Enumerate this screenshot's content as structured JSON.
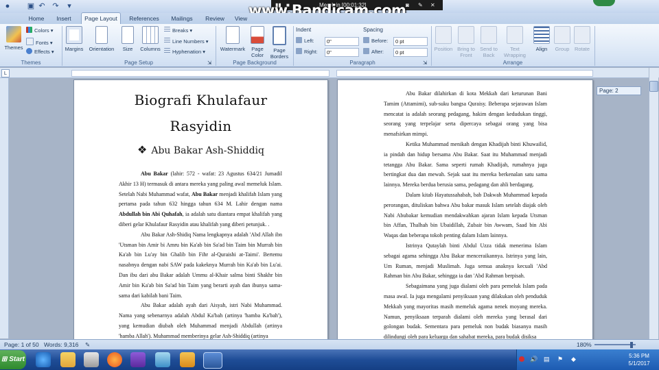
{
  "watermark": "www.Bandicam.com",
  "recorder": {
    "title": "Merek in [00:01:32]"
  },
  "tabs": [
    "Home",
    "Insert",
    "Page Layout",
    "References",
    "Mailings",
    "Review",
    "View"
  ],
  "ribbon": {
    "themes": {
      "themes": "Themes",
      "colors": "Colors",
      "fonts": "Fonts",
      "effects": "Effects",
      "group": "Themes"
    },
    "page_setup": {
      "margins": "Margins",
      "orientation": "Orientation",
      "size": "Size",
      "columns": "Columns",
      "breaks": "Breaks",
      "line_numbers": "Line Numbers",
      "hyphenation": "Hyphenation",
      "group": "Page Setup"
    },
    "page_background": {
      "watermark": "Watermark",
      "page_color": "Page Color",
      "page_borders": "Page Borders",
      "group": "Page Background"
    },
    "paragraph": {
      "indent": "Indent",
      "left_label": "Left:",
      "left_value": "0\"",
      "right_label": "Right:",
      "right_value": "0\"",
      "spacing": "Spacing",
      "before_label": "Before:",
      "before_value": "0 pt",
      "after_label": "After:",
      "after_value": "0 pt",
      "group": "Paragraph"
    },
    "arrange": {
      "position": "Position",
      "bring": "Bring to Front",
      "send": "Send to Back",
      "wrap": "Text Wrapping",
      "align": "Align",
      "group_btn": "Group",
      "rotate": "Rotate",
      "group": "Arrange"
    }
  },
  "page1": {
    "title_line1": "Biografi Khulafaur",
    "title_line2": "Rasyidin",
    "heading": "Abu Bakar Ash-Shiddiq",
    "p1_bold1": "Abu Bakar",
    "p1_t1": " (lahir: 572 - wafat: 23 Agustus 634/21 Jumadil Akhir 13 H) termasuk di antara mereka yang paling awal memeluk Islam. Setelah Nabi Muhammad wafat, ",
    "p1_bold2": "Abu Bakar",
    "p1_t2": " menjadi khalifah Islam yang pertama pada tahun 632 hingga tahun 634 M. Lahir dengan nama ",
    "p1_bold3": "Abdullah bin Abi Quhafah",
    "p1_t3": ", ia adalah satu diantara empat khalifah yang diberi gelar Khulafaur Rasyidin atau khalifah yang diberi petunjuk. .",
    "p2": "Abu Bakar Ash-Shidiq Nama lengkapnya adalah 'Abd Allah ibn 'Utsman bin Amir bi Amru bin Ka'ab bin Sa'ad bin Taim bin Murrah bin Ka'ab bin Lu'ay bin Ghalib bin Fihr al-Quraishi at-Taimi'. Bertemu nasabnya dengan nabi SAW pada kakeknya Murrah bin Ka'ab bin Lu'ai. Dan ibu dari abu Bakar adalah Ummu al-Khair salma binti Shakhr bin Amir bin Ka'ab bin Sa'ad bin Taim yang berarti ayah dan ibunya sama-sama dari kabilah bani Taim.",
    "p3": "Abu Bakar adalah ayah dari Aisyah, istri Nabi Muhammad. Nama yang sebenarnya adalah Abdul Ka'bah (artinya 'hamba Ka'bah'), yang kemudian diubah oleh Muhammad menjadi Abdullah (artinya 'hamba Allah'). Muhammad memberinya gelar Ash-Shiddiq (artinya"
  },
  "page2": {
    "p1": "Abu Bakar dilahirkan di kota Mekkah dari keturunan Bani Tamim (Attamimi), sub-suku bangsa Quraisy. Beberapa sejarawan Islam mencatat ia adalah seorang pedagang, hakim dengan kedudukan tinggi, seorang yang terpelajar serta dipercaya sebagai orang yang bisa menafsirkan mimpi.",
    "p2": "Ketika Muhammad menikah dengan Khadijah binti Khuwailid, ia pindah dan hidup bersama Abu Bakar. Saat itu Muhammad menjadi tetangga Abu Bakar. Sama seperti rumah Khadijah, rumahnya juga bertingkat dua dan mewah. Sejak saat itu mereka berkenalan satu sama lainnya. Mereka berdua berusia sama, pedagang dan ahli berdagang.",
    "p3": "Dalam kitab Hayatussahabah, bab Dakwah Muhammad kepada perorangan, dituliskan bahwa Abu bakar masuk Islam setelah diajak oleh Nabi Abubakar kemudian mendakwahkan ajaran Islam kepada Utsman bin Affan, Thalhah bin Ubaidillah, Zubair bin Awwam, Saad bin Abi Waqas dan beberapa tokoh penting dalam Islam lainnya.",
    "p4": "Istrinya Qutaylah binti Abdul Uzza tidak menerima Islam sebagai agama sehingga Abu Bakar menceraikannya. Istrinya yang lain, Um Ruman, menjadi Muslimah. Juga semua anaknya kecuali 'Abd Rahman bin Abu Bakar, sehingga ia dan 'Abd Rahman berpisah.",
    "p5": "Sebagaimana yang juga dialami oleh para pemeluk Islam pada masa awal. Ia juga mengalami penyiksaan yang dilakukan oleh penduduk Mekkah yang mayoritas masih memeluk agama nenek moyang mereka. Namun, penyiksaan terparah dialami oleh mereka yang berasal dari golongan budak. Sementara para pemeluk non budak biasanya masih dilindungi oleh para keluarga dan sahabat mereka, para budak disiksa"
  },
  "page_tooltip": "Page: 2",
  "status": {
    "page": "Page: 1 of 50",
    "words": "Words: 9,316",
    "zoom": "180%"
  },
  "taskbar": {
    "start": "Start",
    "time": "5:36 PM",
    "date": "5/1/2017"
  }
}
